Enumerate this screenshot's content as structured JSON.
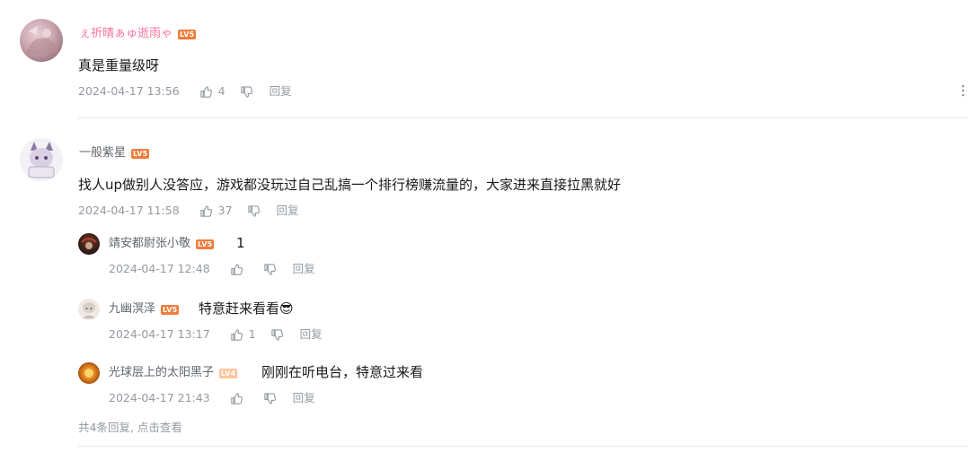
{
  "comments": [
    {
      "username": "ぇ祈晴ぁゅ逝雨ゃ",
      "username_color": "#fb7299",
      "level": "LV5",
      "content": "真是重量级呀",
      "time": "2024-04-17 13:56",
      "likes": "4",
      "reply_label": "回复"
    },
    {
      "username": "一般紫星",
      "username_color": "#61666d",
      "level": "LV5",
      "content": "找人up做别人没答应，游戏都没玩过自己乱搞一个排行榜赚流量的，大家进来直接拉黑就好",
      "time": "2024-04-17 11:58",
      "likes": "37",
      "reply_label": "回复",
      "replies": [
        {
          "username": "靖安都尉张小敬",
          "level": "LV5",
          "content": "1",
          "time": "2024-04-17 12:48",
          "likes": "",
          "reply_label": "回复"
        },
        {
          "username": "九幽溟泽",
          "level": "LV5",
          "content": "特意赶来看看😎",
          "time": "2024-04-17 13:17",
          "likes": "1",
          "reply_label": "回复"
        },
        {
          "username": "光球层上的太阳黑子",
          "level": "LV4",
          "content": "刚刚在听电台，特意过来看",
          "time": "2024-04-17 21:43",
          "likes": "",
          "reply_label": "回复"
        }
      ],
      "replies_footer_prefix": "共4条回复, ",
      "replies_footer_link": "点击查看"
    }
  ],
  "colors": {
    "pink_name": "#fb7299",
    "grey_name": "#61666d",
    "meta": "#9499a0",
    "level_badge": "#f07c3c",
    "level_badge_light": "#ffc59a"
  },
  "icons": [
    "thumbs-up-icon",
    "thumbs-down-icon",
    "more-options-icon"
  ]
}
